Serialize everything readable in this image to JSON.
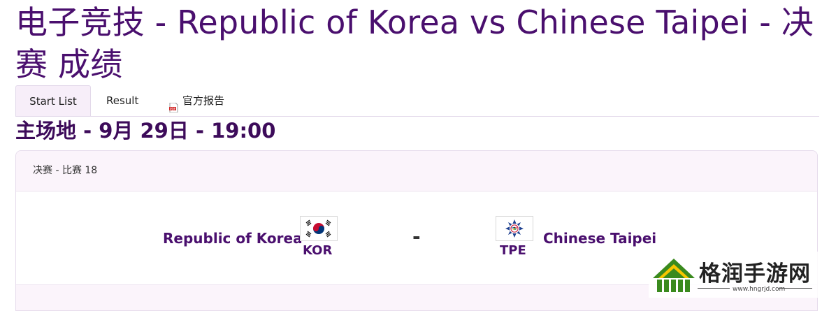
{
  "page": {
    "title": "电子竞技 - Republic of Korea vs Chinese Taipei - 决赛 成绩"
  },
  "tabs": [
    {
      "label": "Start List",
      "active": true
    },
    {
      "label": "Result",
      "active": false
    },
    {
      "label": "官方报告",
      "active": false,
      "icon": "pdf-icon"
    }
  ],
  "venue_line": "主场地 - 9月 29日 - 19:00",
  "match": {
    "header": "决赛  - 比赛 18",
    "separator": "-",
    "home": {
      "name": "Republic of Korea",
      "code": "KOR",
      "flag_icon": "korea-flag-icon"
    },
    "away": {
      "name": "Chinese Taipei",
      "code": "TPE",
      "flag_icon": "chinese-taipei-flag-icon"
    }
  },
  "watermark": {
    "text": "格润手游网",
    "url": "www.hngrjd.com"
  },
  "colors": {
    "title": "#4a0f6e",
    "tab_active_bg": "#f7eef9",
    "card_head_bg": "#fbf4fb",
    "watermark_green": "#3a8a1e"
  }
}
